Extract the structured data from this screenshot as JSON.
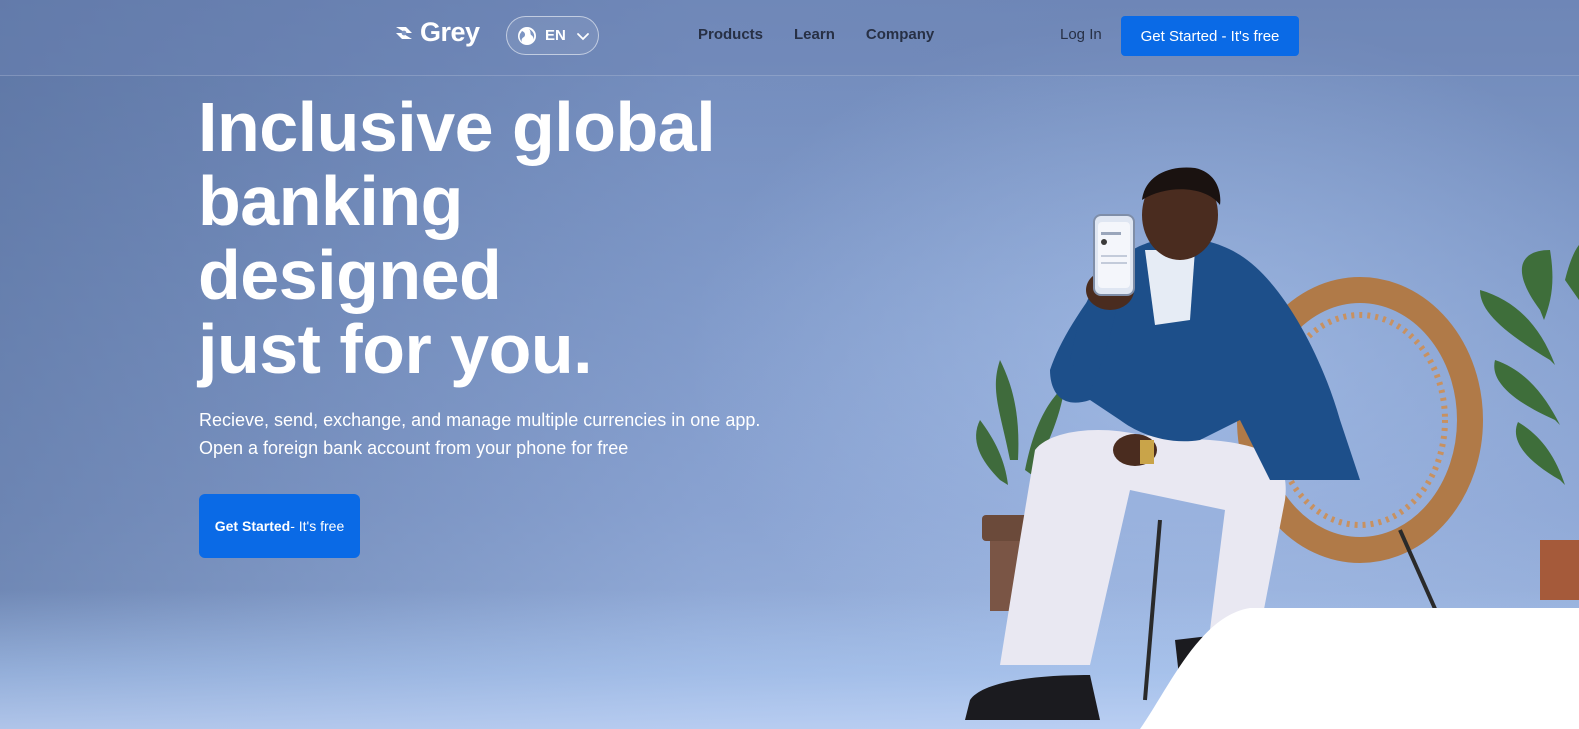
{
  "brand": {
    "name": "Grey"
  },
  "nav": {
    "language": "EN",
    "links": [
      "Products",
      "Learn",
      "Company"
    ],
    "login": "Log In",
    "cta": "Get Started - It's free"
  },
  "hero": {
    "title_lines": [
      "Inclusive global",
      "banking",
      "designed",
      "just for you."
    ],
    "subtitle_lines": [
      "Recieve, send, exchange, and manage multiple currencies in one app.",
      "Open a foreign bank account from your phone for free"
    ],
    "cta_bold": "Get Started",
    "cta_rest": "- It's free"
  },
  "icons": {
    "logo": "grey-logo-icon",
    "language": "globe-icon",
    "dropdown": "chevron-down-icon"
  },
  "colors": {
    "accent": "#0a6ae6",
    "nav_text": "#273045",
    "background": "#829ccb"
  }
}
